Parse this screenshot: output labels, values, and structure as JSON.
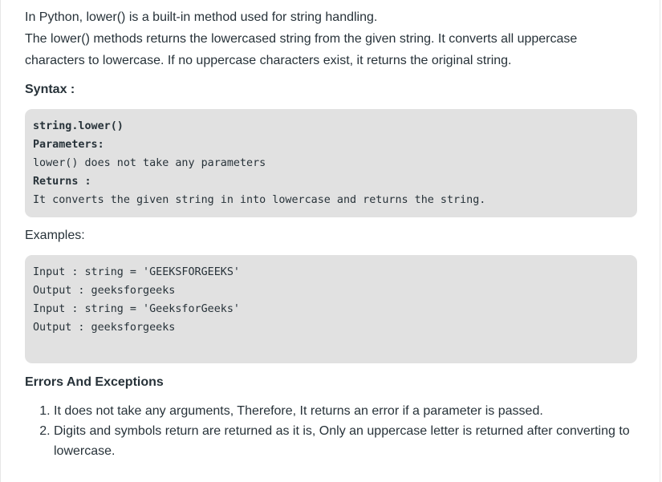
{
  "intro": {
    "line1": "In Python, lower() is a built-in method used for string handling.",
    "line2": "The lower() methods returns the lowercased string from the given string. It converts all uppercase",
    "line3": "characters to lowercase. If no uppercase characters exist, it returns the original string."
  },
  "syntax": {
    "heading": "Syntax :",
    "code": [
      "string.lower()",
      "Parameters:",
      "lower() does not take any parameters",
      "Returns :",
      "It converts the given string in into lowercase and returns the string."
    ]
  },
  "examples": {
    "heading": "Examples:",
    "code": [
      "Input : string = 'GEEKSFORGEEKS'",
      "Output : geeksforgeeks",
      "",
      "Input : string = 'GeeksforGeeks'",
      "Output : geeksforgeeks"
    ]
  },
  "errors": {
    "heading": "Errors And Exceptions",
    "items": [
      "It does not take any arguments, Therefore, It returns an error if a parameter is passed.",
      "Digits and symbols return are returned as it is, Only an uppercase letter is returned after converting to lowercase."
    ]
  }
}
